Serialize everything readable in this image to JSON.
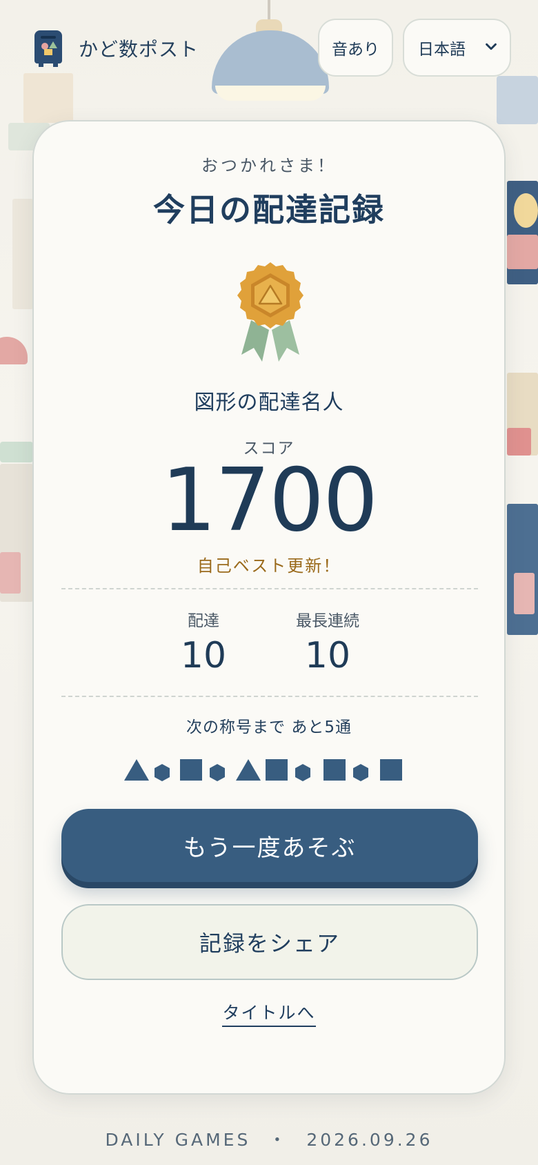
{
  "header": {
    "app_name": "かど数ポスト",
    "sound_button": "音あり",
    "language": {
      "selected": "日本語"
    }
  },
  "result": {
    "eyebrow": "おつかれさま！",
    "title": "今日の配達記録",
    "medal_title": "図形の配達名人",
    "score_label": "スコア",
    "score": "1700",
    "best_message": "自己ベスト更新！",
    "stats": [
      {
        "label": "配達",
        "value": "10"
      },
      {
        "label": "最長連続",
        "value": "10"
      }
    ],
    "next_rank": "次の称号まで あと5通",
    "delivered_shapes": [
      "triangle",
      "hexagon",
      "square",
      "hexagon",
      "triangle",
      "square",
      "hexagon",
      "square",
      "hexagon",
      "square"
    ]
  },
  "actions": {
    "replay": "もう一度あそぶ",
    "share": "記録をシェア",
    "to_title": "タイトルへ"
  },
  "footer": {
    "brand": "DAILY GAMES",
    "separator": "・",
    "date": "2026.09.26"
  },
  "colors": {
    "primary": "#385d80",
    "text": "#1f3b57",
    "best": "#9a6a1b",
    "medal": "#e0a13a",
    "ribbon": "#8fb394"
  }
}
